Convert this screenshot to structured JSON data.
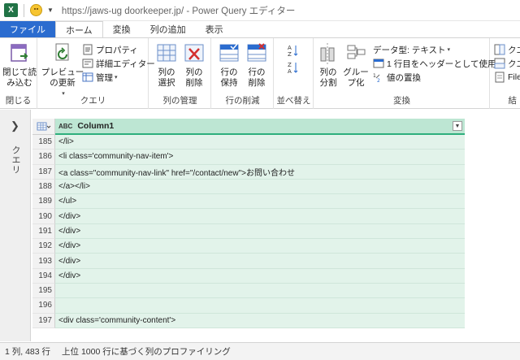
{
  "window": {
    "title": "https://jaws-ug doorkeeper.jp/ - Power Query エディター"
  },
  "tabs": [
    "ファイル",
    "ホーム",
    "変換",
    "列の追加",
    "表示"
  ],
  "ribbon": {
    "close_group": {
      "button": "閉じて読\nみ込む",
      "label": "閉じる"
    },
    "query_group": {
      "preview_refresh": "プレビュー\nの更新",
      "properties": "プロパティ",
      "advanced_editor": "詳細エディター",
      "manage": "管理",
      "label": "クエリ"
    },
    "columns_group": {
      "choose": "列の\n選択",
      "remove": "列の\n削除",
      "label": "列の管理"
    },
    "rows_group": {
      "keep": "行の\n保持",
      "remove": "行の\n削除",
      "label": "行の削減"
    },
    "sort_group": {
      "label": "並べ替え"
    },
    "transform_group": {
      "split": "列の\n分割",
      "group": "グルー\nプ化",
      "datatype": "データ型: テキスト",
      "first_row_header": "1 行目をヘッダーとして使用",
      "replace_values": "値の置換",
      "label": "変換"
    },
    "overflow": {
      "item1": "クエ",
      "item2": "クエ",
      "item3": "File",
      "label": "結"
    }
  },
  "left_pane": {
    "label": "クエリ"
  },
  "grid": {
    "column_type": "ABC",
    "column_name": "Column1",
    "rows": [
      {
        "num": "185",
        "value": "</li>"
      },
      {
        "num": "186",
        "value": "<li class='community-nav-item'>"
      },
      {
        "num": "187",
        "value": "<a class=\"community-nav-link\" href=\"/contact/new\">お問い合わせ"
      },
      {
        "num": "188",
        "value": "</a></li>"
      },
      {
        "num": "189",
        "value": "</ul>"
      },
      {
        "num": "190",
        "value": "</div>"
      },
      {
        "num": "191",
        "value": "</div>"
      },
      {
        "num": "192",
        "value": "</div>"
      },
      {
        "num": "193",
        "value": "</div>"
      },
      {
        "num": "194",
        "value": "</div>"
      },
      {
        "num": "195",
        "value": ""
      },
      {
        "num": "196",
        "value": ""
      },
      {
        "num": "197",
        "value": "<div class='community-content'>"
      }
    ]
  },
  "status": {
    "counts": "1 列, 483 行",
    "profiling": "上位 1000 行に基づく列のプロファイリング"
  },
  "colors": {
    "file_tab": "#2b6ccf",
    "column_header": "#bde6d3",
    "cell_bg": "#e2f3ea",
    "excel_green": "#217346"
  }
}
